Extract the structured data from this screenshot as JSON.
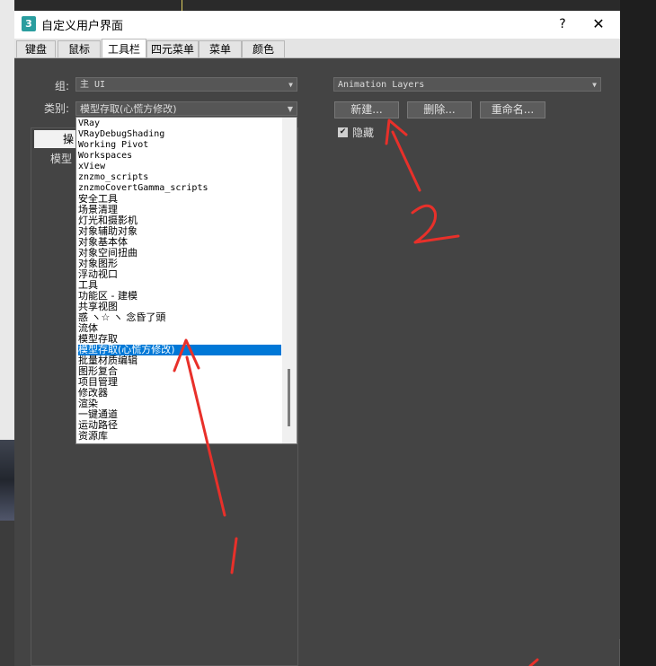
{
  "window": {
    "title": "自定义用户界面",
    "help": "?",
    "close": "✕",
    "app_icon": "3"
  },
  "tabs": [
    {
      "label": "键盘",
      "active": false
    },
    {
      "label": "鼠标",
      "active": false
    },
    {
      "label": "工具栏",
      "active": true
    },
    {
      "label": "四元菜单",
      "active": false
    },
    {
      "label": "菜单",
      "active": false
    },
    {
      "label": "颜色",
      "active": false
    }
  ],
  "group": {
    "label": "组:",
    "value": "主 UI"
  },
  "category": {
    "label": "类别:",
    "value": "模型存取(心慌方修改)",
    "options": [
      "VRay",
      "VRayDebugShading",
      "Working Pivot",
      "Workspaces",
      "xView",
      "znzmo_scripts",
      "znzmoCovertGamma_scripts",
      "安全工具",
      "场景清理",
      "灯光和摄影机",
      "对象辅助对象",
      "对象基本体",
      "对象空间扭曲",
      "对象图形",
      "浮动视口",
      "工具",
      "功能区 - 建模",
      "共享视图",
      "惑 ヽ☆ ヽ 念昏了頭",
      "流体",
      "模型存取",
      "模型存取(心慌方修改)",
      "批量材质编辑",
      "图形复合",
      "项目管理",
      "修改器",
      "渲染",
      "一键通道",
      "运动路径",
      "资源库"
    ],
    "selected_index": 21
  },
  "action_panel": {
    "tab_label": "操",
    "item": "模型"
  },
  "toolbar": {
    "value": "Animation Layers",
    "new_label": "新建...",
    "delete_label": "删除...",
    "rename_label": "重命名...",
    "hide_label": "隐藏",
    "hide_checked": true,
    "check_mark": "✔"
  },
  "annotations": {
    "color": "#e8302a"
  }
}
